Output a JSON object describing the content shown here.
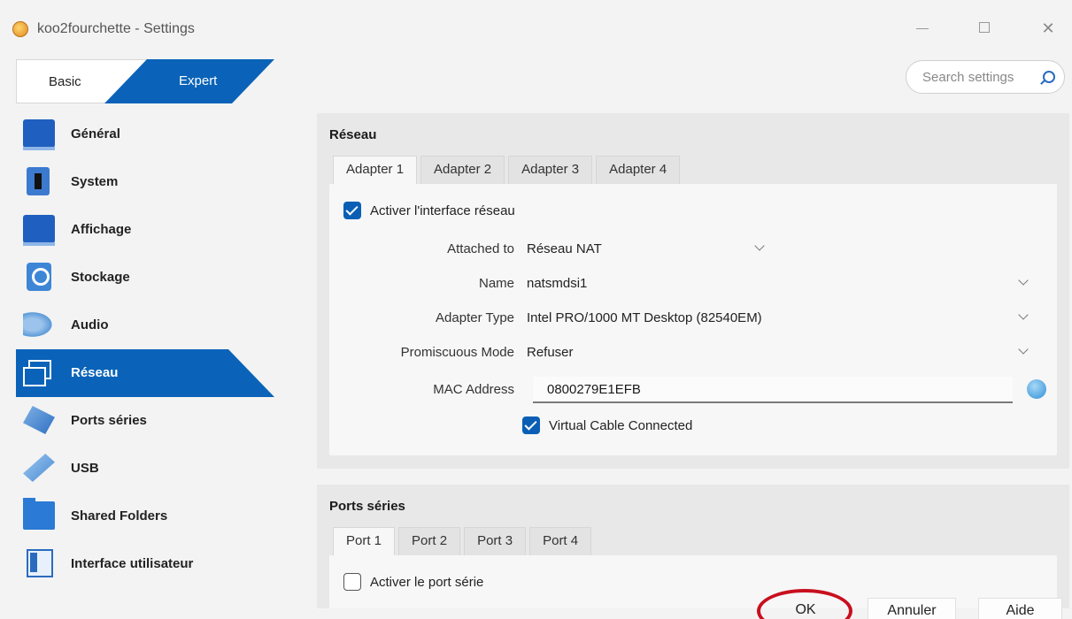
{
  "window": {
    "title": "koo2fourchette - Settings"
  },
  "mode": {
    "basic": "Basic",
    "expert": "Expert"
  },
  "search": {
    "placeholder": "Search settings"
  },
  "sidebar": {
    "items": [
      {
        "label": "Général",
        "icon": "monitor-icon"
      },
      {
        "label": "System",
        "icon": "chip-icon"
      },
      {
        "label": "Affichage",
        "icon": "display-icon"
      },
      {
        "label": "Stockage",
        "icon": "storage-icon"
      },
      {
        "label": "Audio",
        "icon": "audio-icon"
      },
      {
        "label": "Réseau",
        "icon": "network-icon",
        "active": true
      },
      {
        "label": "Ports séries",
        "icon": "serial-port-icon"
      },
      {
        "label": "USB",
        "icon": "usb-icon"
      },
      {
        "label": "Shared Folders",
        "icon": "folder-icon"
      },
      {
        "label": "Interface utilisateur",
        "icon": "ui-icon"
      }
    ]
  },
  "network": {
    "title": "Réseau",
    "tabs": [
      "Adapter 1",
      "Adapter 2",
      "Adapter 3",
      "Adapter 4"
    ],
    "enable_label": "Activer l'interface réseau",
    "attached_label": "Attached to",
    "attached_value": "Réseau NAT",
    "name_label": "Name",
    "name_value": "natsmdsi1",
    "adapter_type_label": "Adapter Type",
    "adapter_type_value": "Intel PRO/1000 MT Desktop (82540EM)",
    "promiscuous_label": "Promiscuous Mode",
    "promiscuous_value": "Refuser",
    "mac_label": "MAC Address",
    "mac_value": "0800279E1EFB",
    "cable_label": "Virtual Cable Connected"
  },
  "serial": {
    "title": "Ports séries",
    "tabs": [
      "Port 1",
      "Port 2",
      "Port 3",
      "Port 4"
    ],
    "enable_label": "Activer le port série"
  },
  "footer": {
    "ok": "OK",
    "cancel": "Annuler",
    "help": "Aide"
  },
  "colors": {
    "accent": "#0a63b8",
    "highlight": "#c8101e"
  }
}
